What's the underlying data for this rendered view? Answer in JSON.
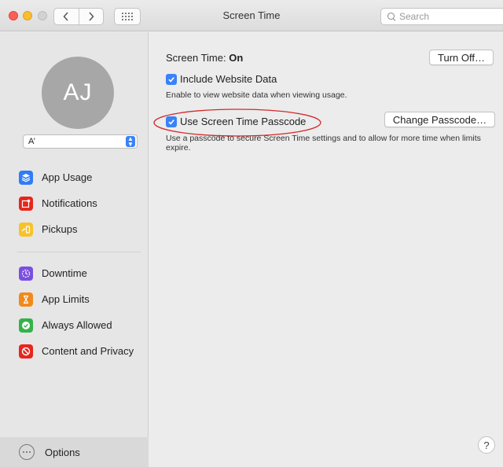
{
  "window": {
    "title": "Screen Time",
    "search_placeholder": "Search"
  },
  "sidebar": {
    "avatar_initials": "AJ",
    "user_select_value": "A’",
    "section1": [
      {
        "label": "App Usage",
        "icon": "app-usage-icon",
        "color": "#2f7cf6"
      },
      {
        "label": "Notifications",
        "icon": "notifications-icon",
        "color": "#e8261c"
      },
      {
        "label": "Pickups",
        "icon": "pickups-icon",
        "color": "#f7c32b"
      }
    ],
    "section2": [
      {
        "label": "Downtime",
        "icon": "downtime-icon",
        "color": "#7a4fe0"
      },
      {
        "label": "App Limits",
        "icon": "app-limits-icon",
        "color": "#f08a1c"
      },
      {
        "label": "Always Allowed",
        "icon": "always-allowed-icon",
        "color": "#34b24a"
      },
      {
        "label": "Content and Privacy",
        "icon": "content-privacy-icon",
        "color": "#e8261c"
      }
    ],
    "options_label": "Options"
  },
  "main": {
    "status_label": "Screen Time:",
    "status_value": "On",
    "turn_off_label": "Turn Off…",
    "include_website": {
      "label": "Include Website Data",
      "checked": true,
      "description": "Enable to view website data when viewing usage."
    },
    "use_passcode": {
      "label": "Use Screen Time Passcode",
      "checked": true,
      "description": "Use a passcode to secure Screen Time settings and to allow for more time when limits expire."
    },
    "change_passcode_label": "Change Passcode…",
    "help_label": "?"
  },
  "colors": {
    "accent": "#3a82f7",
    "annotation_red": "#d42a2a"
  }
}
